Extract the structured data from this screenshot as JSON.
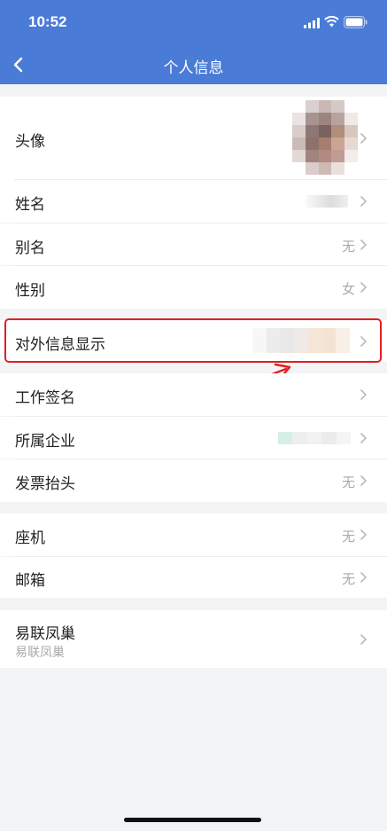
{
  "status": {
    "time": "10:52"
  },
  "nav": {
    "title": "个人信息"
  },
  "rows": {
    "avatar": {
      "label": "头像"
    },
    "name": {
      "label": "姓名"
    },
    "alias": {
      "label": "别名",
      "value": "无"
    },
    "gender": {
      "label": "性别",
      "value": "女"
    },
    "external_info": {
      "label": "对外信息显示"
    },
    "work_signature": {
      "label": "工作签名"
    },
    "company": {
      "label": "所属企业"
    },
    "invoice_title": {
      "label": "发票抬头",
      "value": "无"
    },
    "landline": {
      "label": "座机",
      "value": "无"
    },
    "email": {
      "label": "邮箱",
      "value": "无"
    },
    "app": {
      "label": "易联凤巢",
      "subtitle": "易联凤巢"
    }
  },
  "colors": {
    "header": "#4a7bd6",
    "highlight": "#e02020",
    "background": "#f3f4f6"
  }
}
